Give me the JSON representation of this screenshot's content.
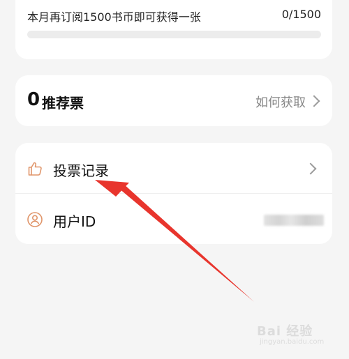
{
  "progress_card": {
    "text": "本月再订阅1500书币即可获得一张",
    "count": "0/1500",
    "progress_fraction": 0
  },
  "ticket_card": {
    "count": "0",
    "label": "推荐票",
    "how_to_get": "如何获取"
  },
  "list": {
    "items": [
      {
        "label": "投票记录",
        "icon": "thumbs-up-icon"
      },
      {
        "label": "用户ID",
        "icon": "user-icon"
      }
    ]
  },
  "colors": {
    "accent_icon": "#e0956a",
    "annotation_arrow": "#e8352d",
    "background": "#f5f5f5"
  },
  "watermark": {
    "text": "Bai 经验",
    "sub": "jingyan.baidu.com"
  }
}
